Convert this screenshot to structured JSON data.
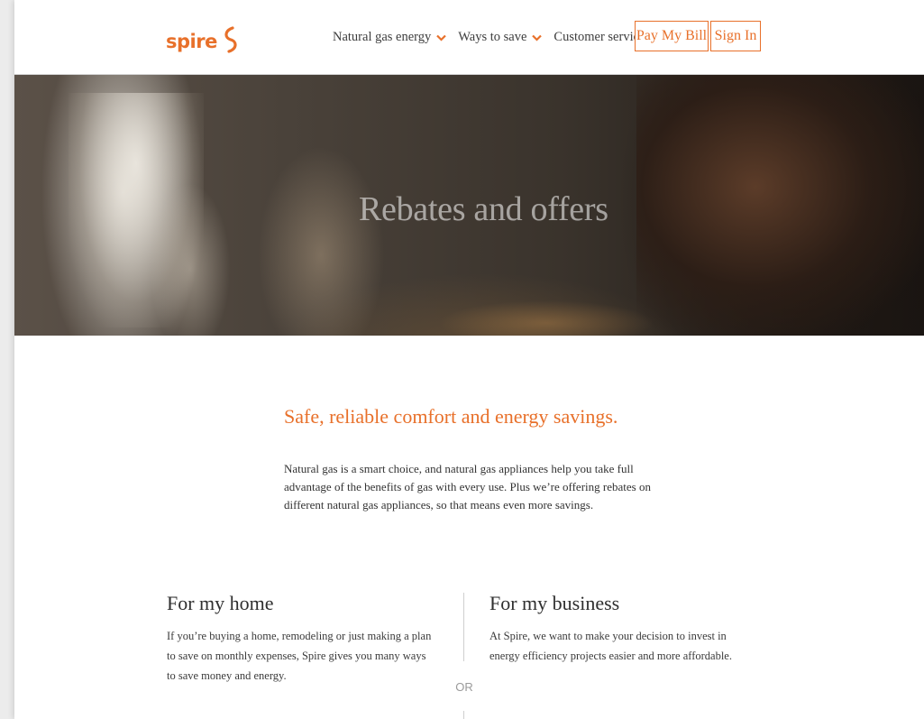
{
  "header": {
    "logo_text": "spire",
    "nav": [
      {
        "label": "Natural gas energy"
      },
      {
        "label": "Ways to save"
      },
      {
        "label": "Customer service"
      }
    ],
    "pay_bill_label": "Pay My Bill",
    "sign_in_label": "Sign In"
  },
  "hero": {
    "title": "Rebates and offers"
  },
  "intro": {
    "heading": "Safe, reliable comfort and energy savings.",
    "body": "Natural gas is a smart choice, and natural gas appliances help you take full advantage of the benefits of gas with every use. Plus we’re offering rebates on different natural gas appliances, so that means even more savings."
  },
  "home": {
    "title": "For my home",
    "body": "If you’re buying a home, remodeling or just making a plan to save on monthly expenses, Spire gives you many ways to save money and energy."
  },
  "business": {
    "title": "For my business",
    "body": "At Spire, we want to make your decision to invest in energy efficiency projects easier and more affordable."
  },
  "divider_label": "OR",
  "colors": {
    "brand_orange": "#e8702a",
    "text_dark": "#333333",
    "divider": "#cfcfcf"
  },
  "icons": {
    "logo_mark": "spire-s-mark-icon",
    "nav_chevron": "chevron-down-icon"
  }
}
